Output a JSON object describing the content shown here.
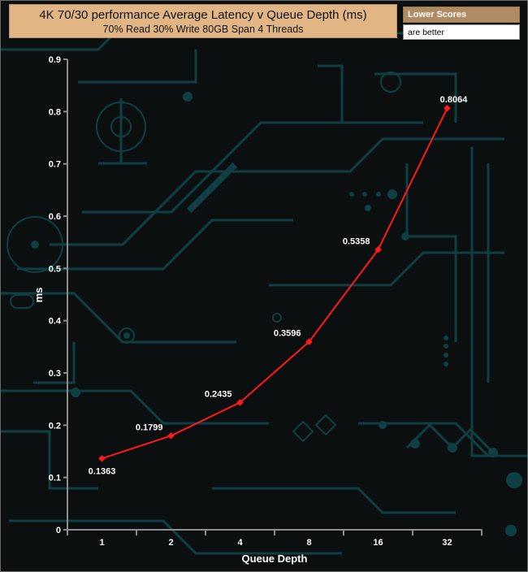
{
  "header": {
    "title": "4K 70/30 performance Average Latency v Queue Depth (ms)",
    "subtitle": "70% Read 30% Write 80GB Span 4 Threads"
  },
  "note": {
    "heading": "Lower Scores",
    "body": "are better"
  },
  "colors": {
    "series": "#ff1a1a",
    "axis": "#8c8c8c",
    "title_bg": "#e2b584",
    "circuit": "#0f3f42"
  },
  "chart_data": {
    "type": "line",
    "title": "4K 70/30 performance Average Latency v Queue Depth (ms)",
    "subtitle": "70% Read 30% Write 80GB Span 4 Threads",
    "xlabel": "Queue Depth",
    "ylabel": "ms",
    "categories": [
      "1",
      "2",
      "4",
      "8",
      "16",
      "32"
    ],
    "series": [
      {
        "values": [
          0.1363,
          0.1799,
          0.2435,
          0.3596,
          0.5358,
          0.8064
        ]
      }
    ],
    "data_labels": [
      "0.1363",
      "0.1799",
      "0.2435",
      "0.3596",
      "0.5358",
      "0.8064"
    ],
    "ylim": [
      0,
      0.9
    ],
    "yticks": [
      "0",
      "0.1",
      "0.2",
      "0.3",
      "0.4",
      "0.5",
      "0.6",
      "0.7",
      "0.8",
      "0.9"
    ],
    "grid": false,
    "legend": "none"
  }
}
